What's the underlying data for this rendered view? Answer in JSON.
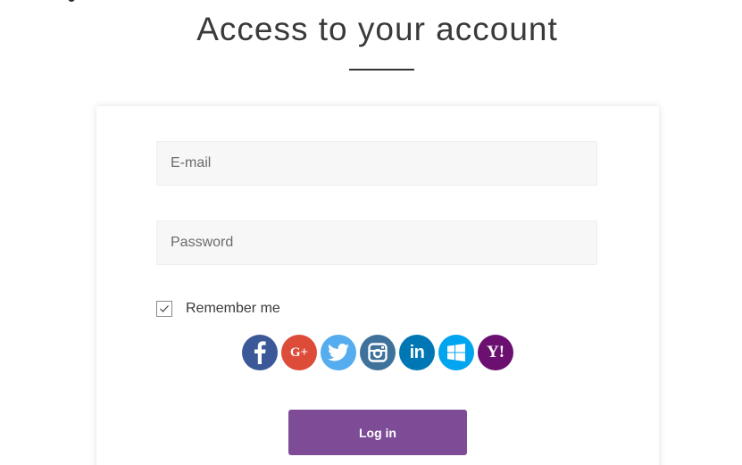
{
  "page": {
    "title": "Access to your account"
  },
  "form": {
    "email_placeholder": "E-mail",
    "password_placeholder": "Password",
    "remember_label": "Remember me",
    "remember_checked": true,
    "login_label": "Log in"
  },
  "social_logins": [
    {
      "name": "facebook",
      "icon": "facebook-icon",
      "color": "#3b5998"
    },
    {
      "name": "google-plus",
      "icon": "google-plus-icon",
      "color": "#dd4b39",
      "glyph": "G+"
    },
    {
      "name": "twitter",
      "icon": "twitter-icon",
      "color": "#55acee"
    },
    {
      "name": "instagram",
      "icon": "instagram-icon",
      "color": "#3f729b"
    },
    {
      "name": "linkedin",
      "icon": "linkedin-icon",
      "color": "#0077b5",
      "glyph": "in"
    },
    {
      "name": "windows",
      "icon": "windows-icon",
      "color": "#00a4ef"
    },
    {
      "name": "yahoo",
      "icon": "yahoo-icon",
      "color": "#6b0f70",
      "glyph": "Y!"
    }
  ],
  "colors": {
    "accent": "#7e4c97",
    "field_bg": "#f7f7f7"
  }
}
